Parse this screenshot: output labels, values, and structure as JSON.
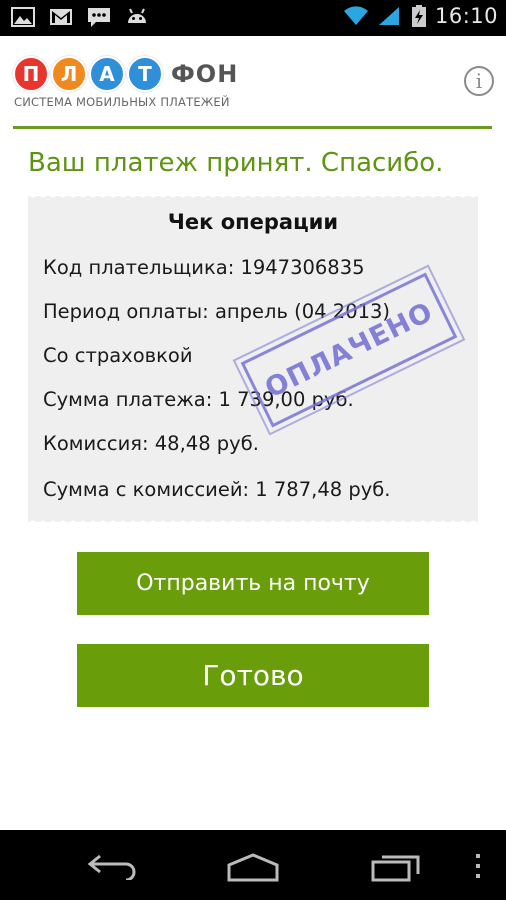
{
  "status_bar": {
    "time": "16:10",
    "left_icons": [
      "image-icon",
      "gmail-icon",
      "chat-icon",
      "android-icon"
    ],
    "right_icons": [
      "wifi-icon",
      "signal-icon",
      "battery-charging-icon"
    ]
  },
  "header": {
    "logo_letters": [
      "П",
      "Л",
      "А",
      "Т"
    ],
    "logo_letter_colors": [
      "#e8352e",
      "#f08a1e",
      "#2f8fd8",
      "#2f8fd8"
    ],
    "logo_rest": "ФОН",
    "logo_subtitle": "СИСТЕМА МОБИЛЬНЫХ ПЛАТЕЖЕЙ",
    "info_label": "i"
  },
  "main": {
    "success_message": "Ваш платеж принят. Спасибо.",
    "receipt": {
      "title": "Чек операции",
      "lines": [
        "Код плательщика: 1947306835",
        "Период оплаты: апрель (04 2013)",
        "Со страховкой",
        "Сумма платежа: 1 739,00 руб.",
        "Комиссия: 48,48 руб.",
        "Сумма с комиссией: 1 787,48 руб."
      ],
      "stamp": "ОПЛАЧЕНО"
    },
    "buttons": {
      "send_email": "Отправить на почту",
      "done": "Готово"
    }
  },
  "colors": {
    "accent_green": "#6a9d0a",
    "title_green": "#5f9412",
    "stamp_color": "#706cd2"
  },
  "nav_bar": {
    "icons": [
      "back-icon",
      "home-icon",
      "recent-apps-icon",
      "menu-icon"
    ]
  }
}
